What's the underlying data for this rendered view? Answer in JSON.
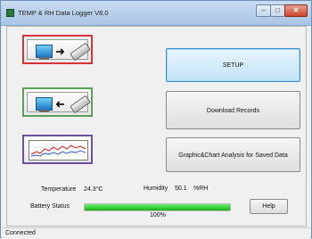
{
  "window": {
    "title": "TEMP & RH Data Logger V8.0",
    "controls": {
      "minimize": "–",
      "maximize": "□",
      "close": "✕"
    }
  },
  "icons": {
    "upload": "computer-to-logger-icon",
    "download": "logger-to-computer-icon",
    "chart": "chart-icon"
  },
  "buttons": {
    "setup": "SETUP",
    "download": "Download Records",
    "graphic": "Graphic&Chart Analysis for Saved Data",
    "help": "Help"
  },
  "readings": {
    "temperature_label": "Temperature",
    "temperature_value": "24.3°C",
    "humidity_label": "Humidity",
    "humidity_value": "50.1",
    "humidity_unit": "%RH"
  },
  "battery": {
    "label": "Battery Status",
    "percent_text": "100%",
    "level": 1.0
  },
  "status_bar": {
    "text": "Connected"
  }
}
